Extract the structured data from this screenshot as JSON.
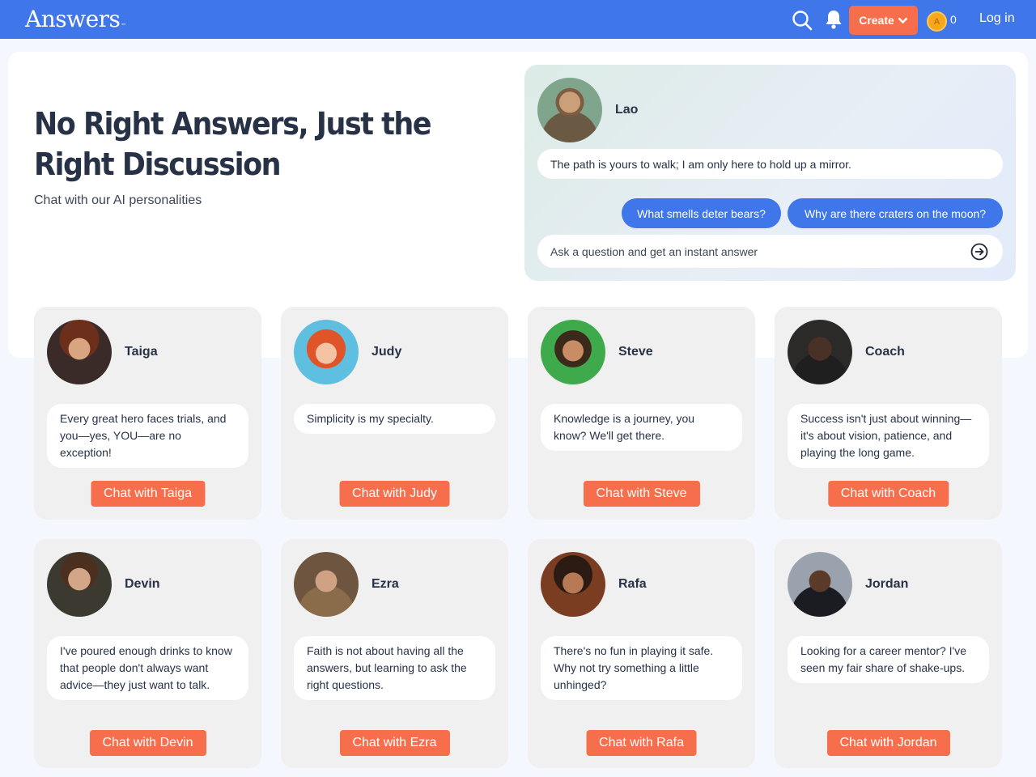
{
  "header": {
    "logo_text": "Answers",
    "logo_mark": "™",
    "create_label": "Create",
    "coin_symbol": "A",
    "coin_count": "0",
    "login_label": "Log in"
  },
  "hero": {
    "title": "No Right Answers, Just the Right Discussion",
    "subtitle": "Chat with our AI personalities"
  },
  "chat_panel": {
    "persona_name": "Lao",
    "persona_message": "The path is yours to walk; I am only here to hold up a mirror.",
    "suggestions": [
      "What smells deter bears?",
      "Why are there craters on the moon?"
    ],
    "ask_placeholder": "Ask a question and get an instant answer"
  },
  "personas": [
    {
      "name": "Taiga",
      "quote": "Every great hero faces trials, and you—yes, YOU—are no exception!",
      "button": "Chat with Taiga"
    },
    {
      "name": "Judy",
      "quote": "Simplicity is my specialty.",
      "button": "Chat with Judy"
    },
    {
      "name": "Steve",
      "quote": "Knowledge is a journey, you know? We'll get there.",
      "button": "Chat with Steve"
    },
    {
      "name": "Coach",
      "quote": "Success isn't just about winning—it's about vision, patience, and playing the long game.",
      "button": "Chat with Coach"
    },
    {
      "name": "Devin",
      "quote": "I've poured enough drinks to know that people don't always want advice—they just want to talk.",
      "button": "Chat with Devin"
    },
    {
      "name": "Ezra",
      "quote": "Faith is not about having all the answers, but learning to ask the right questions.",
      "button": "Chat with Ezra"
    },
    {
      "name": "Rafa",
      "quote": "There's no fun in playing it safe. Why not try something a little unhinged?",
      "button": "Chat with Rafa"
    },
    {
      "name": "Jordan",
      "quote": "Looking for a career mentor? I've seen my fair share of shake-ups.",
      "button": "Chat with Jordan"
    }
  ],
  "colors": {
    "header_bg": "#3f76ea",
    "accent_orange": "#f66e4b",
    "suggestion_blue": "#3f76ea",
    "coin_gold": "#f7a71c"
  },
  "icons": [
    "search-icon",
    "bell-icon",
    "chevron-down-icon",
    "coin-icon",
    "send-arrow-icon"
  ]
}
